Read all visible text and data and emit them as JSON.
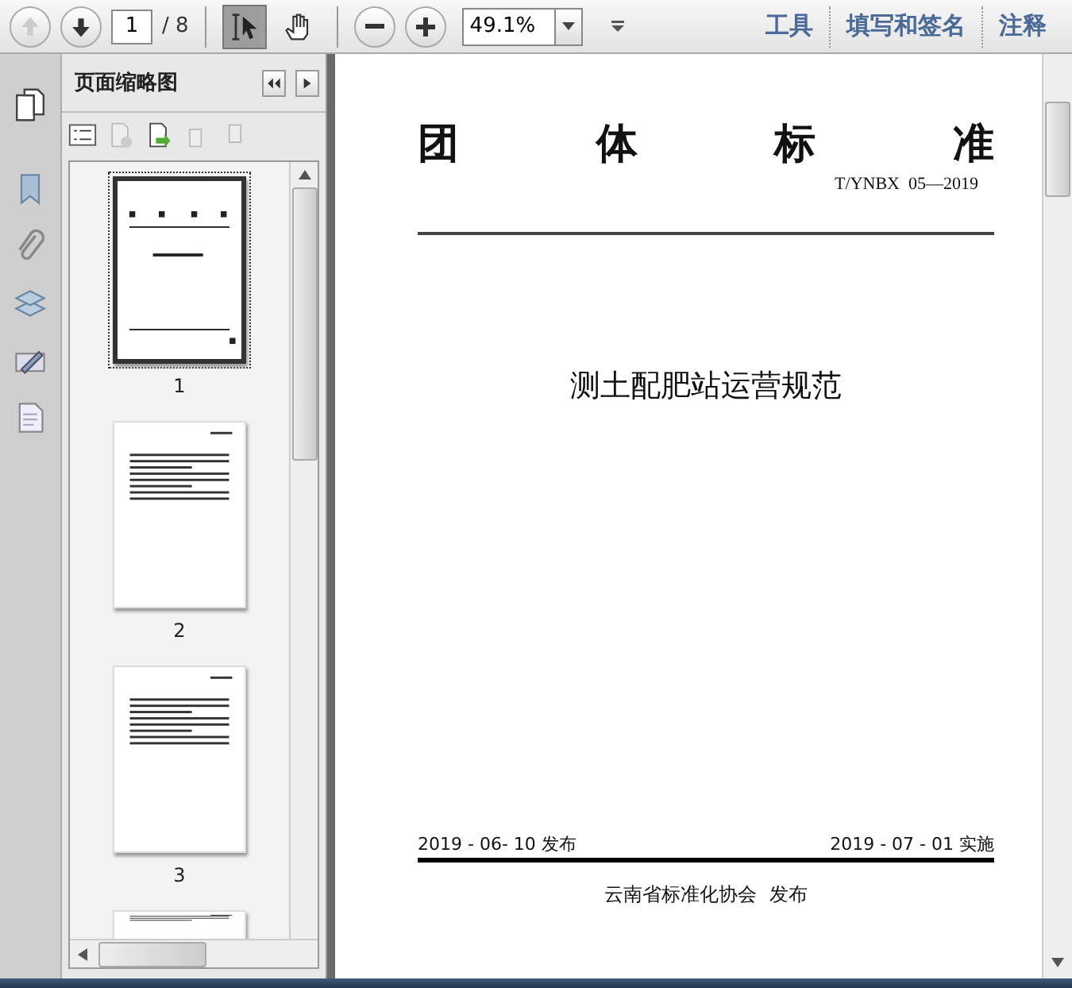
{
  "toolbar": {
    "page_current": "1",
    "page_total": "/ 8",
    "zoom": "49.1%",
    "tools": [
      {
        "kind": "select",
        "selected": true
      },
      {
        "kind": "hand",
        "selected": false
      }
    ],
    "links": [
      "工具",
      "填写和签名",
      "注释"
    ]
  },
  "side_icons": [
    {
      "kind": "bookmark"
    },
    {
      "kind": "attachment"
    },
    {
      "kind": "layers"
    },
    {
      "kind": "signature"
    },
    {
      "kind": "content"
    }
  ],
  "thumbnails_panel": {
    "title": "页面缩略图",
    "thumbnails": [
      {
        "kind": "cover",
        "label": "1",
        "selected": true
      },
      {
        "kind": "text",
        "label": "2",
        "selected": false
      },
      {
        "kind": "text",
        "label": "3",
        "selected": false
      },
      {
        "kind": "partial",
        "selected": false
      }
    ]
  },
  "document": {
    "heading_chars": [
      "团",
      "体",
      "标",
      "准"
    ],
    "code": "T/YNBX  05—2019",
    "title": "测土配肥站运营规范",
    "publish_date": "2019 - 06- 10 发布",
    "effective_date": "2019 - 07 - 01 实施",
    "issuer": "云南省标准化协会  发布"
  }
}
